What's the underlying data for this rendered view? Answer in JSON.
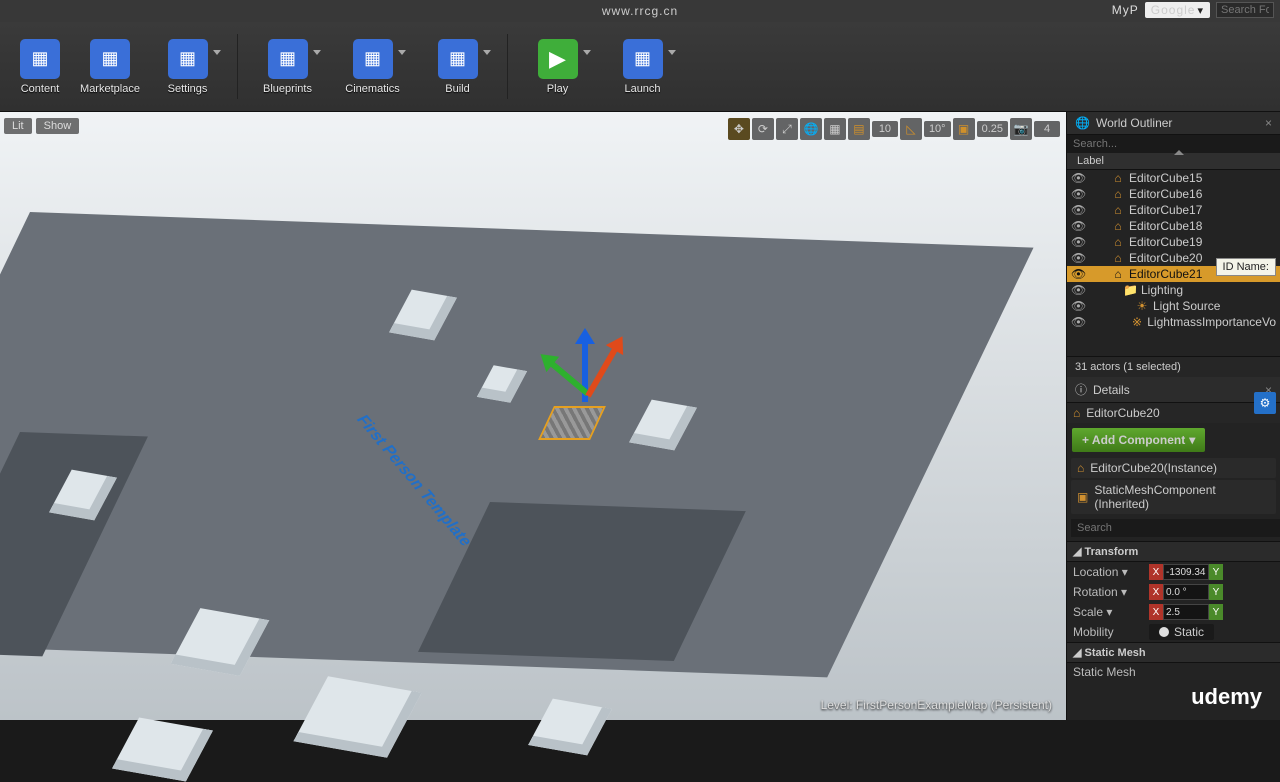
{
  "addr_url": "www.rrcg.cn",
  "topright": {
    "user": "MyP",
    "google": "Google",
    "search_ph": "Search For"
  },
  "toolbar": [
    {
      "label": "Content",
      "color": "#3a6fd8"
    },
    {
      "label": "Marketplace",
      "color": "#3a6fd8"
    },
    {
      "label": "Settings",
      "color": "#3a6fd8",
      "dd": true
    },
    {
      "label": "Blueprints",
      "color": "#3a6fd8",
      "dd": true,
      "sep_before": true
    },
    {
      "label": "Cinematics",
      "color": "#3a6fd8",
      "dd": true
    },
    {
      "label": "Build",
      "color": "#3a6fd8",
      "dd": true
    },
    {
      "label": "Play",
      "color": "#3fae3a",
      "dd": true,
      "sep_before": true
    },
    {
      "label": "Launch",
      "color": "#3a6fd8",
      "dd": true
    }
  ],
  "viewport": {
    "mode": "Lit",
    "show": "Show",
    "snap_pos": "10",
    "snap_rot": "10°",
    "snap_scale": "0.25",
    "cam_speed": "4",
    "status": "Level:  FirstPersonExampleMap (Persistent)",
    "fp_text": "First Person Template"
  },
  "outliner": {
    "title": "World Outliner",
    "search_ph": "Search...",
    "label_hdr": "Label",
    "rows": [
      {
        "name": "EditorCube15",
        "ico": "⌂"
      },
      {
        "name": "EditorCube16",
        "ico": "⌂"
      },
      {
        "name": "EditorCube17",
        "ico": "⌂"
      },
      {
        "name": "EditorCube18",
        "ico": "⌂"
      },
      {
        "name": "EditorCube19",
        "ico": "⌂"
      },
      {
        "name": "EditorCube20",
        "ico": "⌂"
      },
      {
        "name": "EditorCube21",
        "ico": "⌂",
        "sel": true
      },
      {
        "name": "Lighting",
        "ico": "📁",
        "indent": 1
      },
      {
        "name": "Light Source",
        "ico": "☀",
        "indent": 2
      },
      {
        "name": "LightmassImportanceVo",
        "ico": "※",
        "indent": 2,
        "dim": true
      }
    ],
    "status": "31 actors (1 selected)",
    "tooltip": "ID Name:"
  },
  "details": {
    "title": "Details",
    "actor": "EditorCube20",
    "add_comp": "+ Add Component",
    "components": [
      {
        "name": "EditorCube20(Instance)",
        "ico": "⌂"
      },
      {
        "name": "StaticMeshComponent (Inherited)",
        "ico": "▣"
      }
    ],
    "search_ph": "Search",
    "sections": {
      "transform": "Transform",
      "location": "Location",
      "rotation": "Rotation",
      "scale": "Scale",
      "mobility": "Mobility",
      "loc_x": "-1309.34",
      "rot_x": "0.0 °",
      "scl_x": "2.5",
      "mob_opt": "Static",
      "staticmesh": "Static Mesh",
      "sm_row": "Static Mesh"
    }
  },
  "brand": "udemy"
}
